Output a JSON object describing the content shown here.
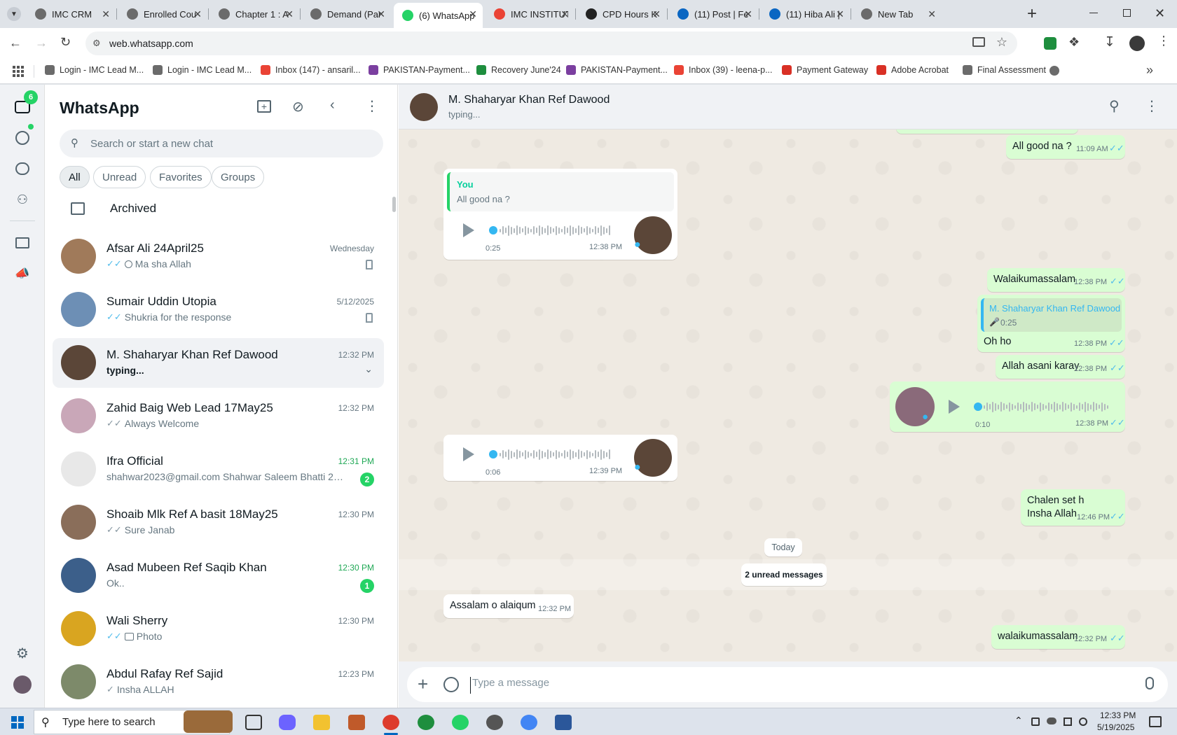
{
  "browser": {
    "tabs": [
      {
        "title": "IMC CRM",
        "color": "#6b6b6b"
      },
      {
        "title": "Enrolled Cou",
        "color": "#6b6b6b"
      },
      {
        "title": "Chapter 1 : A",
        "color": "#6b6b6b"
      },
      {
        "title": "Demand (Par",
        "color": "#6b6b6b"
      },
      {
        "title": "(6) WhatsApp",
        "color": "#25d366",
        "active": true
      },
      {
        "title": "IMC INSTITUT",
        "color": "#ea4335"
      },
      {
        "title": "CPD Hours K",
        "color": "#222222"
      },
      {
        "title": "(11) Post | Fe",
        "color": "#0a66c2"
      },
      {
        "title": "(11) Hiba Ali |",
        "color": "#0a66c2"
      },
      {
        "title": "New Tab",
        "color": "#6b6b6b"
      }
    ],
    "url": "web.whatsapp.com",
    "bookmarks": [
      {
        "label": "Login - IMC Lead M...",
        "color": "#6b6b6b"
      },
      {
        "label": "Login - IMC Lead M...",
        "color": "#6b6b6b"
      },
      {
        "label": "Inbox (147) - ansaril...",
        "color": "#ea4335"
      },
      {
        "label": "PAKISTAN-Payment...",
        "color": "#7b3fa0"
      },
      {
        "label": "Recovery June'24",
        "color": "#1e8e3e"
      },
      {
        "label": "PAKISTAN-Payment...",
        "color": "#7b3fa0"
      },
      {
        "label": "Inbox (39) - leena-p...",
        "color": "#ea4335"
      },
      {
        "label": "Payment Gateway",
        "color": "#d93025"
      },
      {
        "label": "Adobe Acrobat",
        "color": "#d93025"
      },
      {
        "label": "Final Assessment",
        "color": "#6b6b6b"
      }
    ]
  },
  "rail": {
    "chats_badge": "6"
  },
  "sidebar": {
    "title": "WhatsApp",
    "search_placeholder": "Search or start a new chat",
    "filters": [
      "All",
      "Unread",
      "Favorites",
      "Groups"
    ],
    "archived_label": "Archived",
    "chats": [
      {
        "name": "Afsar Ali 24April25",
        "preview": "Ma sha Allah",
        "time": "Wednesday",
        "ticks": "blue",
        "pinned": true,
        "color": "#a07a5a"
      },
      {
        "name": "Sumair Uddin Utopia",
        "preview": "Shukria for the response",
        "time": "5/12/2025",
        "ticks": "blue",
        "pinned": true,
        "color": "#6d8fb5"
      },
      {
        "name": "M. Shaharyar Khan Ref Dawood",
        "preview": "typing...",
        "time": "12:32 PM",
        "typing": true,
        "selected": true,
        "color": "#5b4638"
      },
      {
        "name": "Zahid Baig Web Lead 17May25",
        "preview": "Always Welcome",
        "time": "12:32 PM",
        "ticks": "grey",
        "color": "#c9a7b8"
      },
      {
        "name": "Ifra Official",
        "preview": "shahwar2023@gmail.com Shahwar Saleem Bhatti 2nd l...",
        "time": "12:31 PM",
        "unread": "2",
        "green_time": true,
        "color": "#e8e8e8"
      },
      {
        "name": "Shoaib Mlk Ref A basit 18May25",
        "preview": "Sure Janab",
        "time": "12:30 PM",
        "ticks": "grey",
        "color": "#8a6e5a"
      },
      {
        "name": "Asad Mubeen Ref Saqib Khan",
        "preview": "Ok..",
        "time": "12:30 PM",
        "unread": "1",
        "green_time": true,
        "color": "#3c5f8a"
      },
      {
        "name": "Wali Sherry",
        "preview": "Photo",
        "time": "12:30 PM",
        "ticks": "blue",
        "photo": true,
        "color": "#d9a520"
      },
      {
        "name": "Abdul Rafay Ref Sajid",
        "preview": "Insha ALLAH",
        "time": "12:23 PM",
        "ticks": "single",
        "color": "#7d8a6a"
      }
    ]
  },
  "conversation": {
    "contact_name": "M. Shaharyar Khan Ref Dawood",
    "status": "typing...",
    "messages": {
      "m1": {
        "text": "All good na ?",
        "time": "11:09 AM"
      },
      "m2": {
        "quote_author": "You",
        "quote_text": "All good na ?",
        "duration": "0:25",
        "time": "12:38 PM"
      },
      "m3": {
        "text": "Walaikumassalam",
        "time": "12:38 PM"
      },
      "m4": {
        "quote_author": "M. Shaharyar Khan Ref Dawood",
        "quote_duration": "0:25",
        "text": "Oh ho",
        "time": "12:38 PM"
      },
      "m5": {
        "text": "Allah asani karay",
        "time": "12:38 PM"
      },
      "m6": {
        "duration": "0:10",
        "time": "12:38 PM"
      },
      "m7": {
        "duration": "0:06",
        "time": "12:39 PM"
      },
      "m8": {
        "line1": "Chalen set h",
        "line2": "Insha Allah",
        "time": "12:46 PM"
      },
      "m9": {
        "text": "Assalam o alaiqum",
        "time": "12:32 PM"
      },
      "m10": {
        "text": "walaikumassalam",
        "time": "12:32 PM"
      }
    },
    "date_divider": "Today",
    "unread_divider": "2 unread messages",
    "composer_placeholder": "Type a message"
  },
  "taskbar": {
    "search_placeholder": "Type here to search",
    "time": "12:33 PM",
    "date": "5/19/2025"
  }
}
